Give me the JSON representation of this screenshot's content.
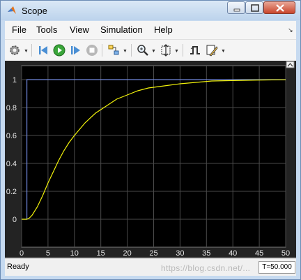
{
  "window": {
    "title": "Scope"
  },
  "menu": [
    "File",
    "Tools",
    "View",
    "Simulation",
    "Help"
  ],
  "toolbar": {
    "icons": [
      "gear-icon",
      "step-back-icon",
      "run-icon",
      "step-forward-icon",
      "stop-icon",
      "highlight-icon",
      "zoom-icon",
      "autoscale-icon",
      "triggers-icon",
      "style-icon"
    ]
  },
  "status": {
    "text": "Ready",
    "time": "T=50.000",
    "watermark": "https://blog.csdn.net/..."
  },
  "chart_data": {
    "type": "line",
    "xlim": [
      0,
      50
    ],
    "ylim": [
      -0.2,
      1.1
    ],
    "xticks": [
      0,
      5,
      10,
      15,
      20,
      25,
      30,
      35,
      40,
      45,
      50
    ],
    "yticks": [
      0,
      0.2,
      0.4,
      0.6,
      0.8,
      1
    ],
    "grid": true,
    "series": [
      {
        "color": "#6f86d9",
        "x": [
          0,
          1,
          1,
          50
        ],
        "y": [
          0,
          0,
          1,
          1
        ]
      },
      {
        "color": "#f2f20a",
        "x": [
          0,
          1,
          1.5,
          2,
          3,
          4,
          5,
          6,
          7,
          8,
          9,
          10,
          12,
          14,
          16,
          18,
          20,
          22,
          24,
          26,
          28,
          30,
          33,
          36,
          40,
          45,
          50
        ],
        "y": [
          0,
          0,
          0.01,
          0.03,
          0.09,
          0.17,
          0.26,
          0.34,
          0.42,
          0.49,
          0.55,
          0.6,
          0.69,
          0.76,
          0.81,
          0.86,
          0.89,
          0.92,
          0.94,
          0.95,
          0.96,
          0.97,
          0.98,
          0.99,
          0.993,
          0.997,
          0.999
        ]
      }
    ]
  }
}
